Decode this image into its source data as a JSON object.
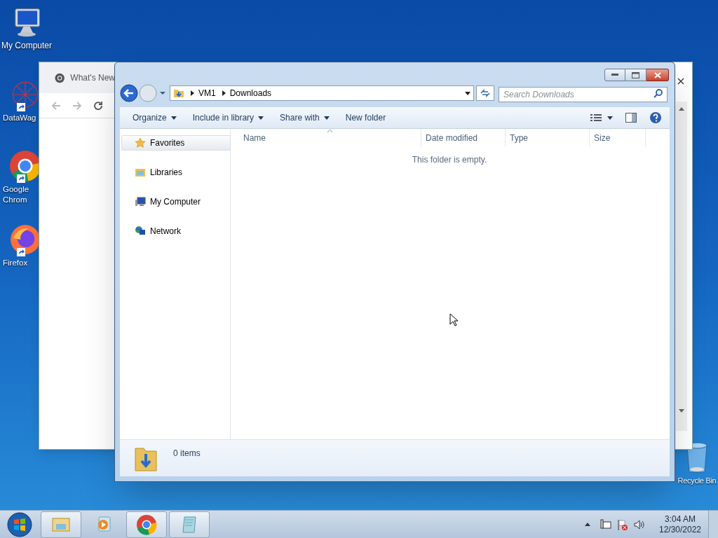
{
  "desktop_icons": [
    {
      "kind": "computer",
      "label": "My Computer",
      "shortcut": false
    },
    {
      "kind": "datawagon",
      "label": "DataWag",
      "shortcut": true
    },
    {
      "kind": "chrome",
      "label": "Google Chrom",
      "shortcut": true
    },
    {
      "kind": "firefox",
      "label": "Firefox",
      "shortcut": true
    }
  ],
  "recycle_bin": {
    "label": "Recycle Bin"
  },
  "background_window": {
    "tab_title": "What's New"
  },
  "explorer": {
    "breadcrumbs": [
      "VM1",
      "Downloads"
    ],
    "search": {
      "placeholder": "Search Downloads"
    },
    "toolbar": [
      {
        "label": "Organize",
        "dropdown": true
      },
      {
        "label": "Include in library",
        "dropdown": true
      },
      {
        "label": "Share with",
        "dropdown": true
      },
      {
        "label": "New folder",
        "dropdown": false
      }
    ],
    "nav": [
      {
        "kind": "star",
        "label": "Favorites",
        "selected": true
      },
      {
        "kind": "library",
        "label": "Libraries",
        "selected": false
      },
      {
        "kind": "computer",
        "label": "My Computer",
        "selected": false
      },
      {
        "kind": "network",
        "label": "Network",
        "selected": false
      }
    ],
    "columns": [
      "Name",
      "Date modified",
      "Type",
      "Size"
    ],
    "empty_message": "This folder is empty.",
    "status": "0 items"
  },
  "taskbar": {
    "apps": [
      {
        "kind": "explorer",
        "active": true
      },
      {
        "kind": "media",
        "active": false
      },
      {
        "kind": "chrome",
        "active": true
      },
      {
        "kind": "notepad",
        "active": true
      }
    ],
    "clock": {
      "time": "3:04 AM",
      "date": "12/30/2022"
    }
  }
}
